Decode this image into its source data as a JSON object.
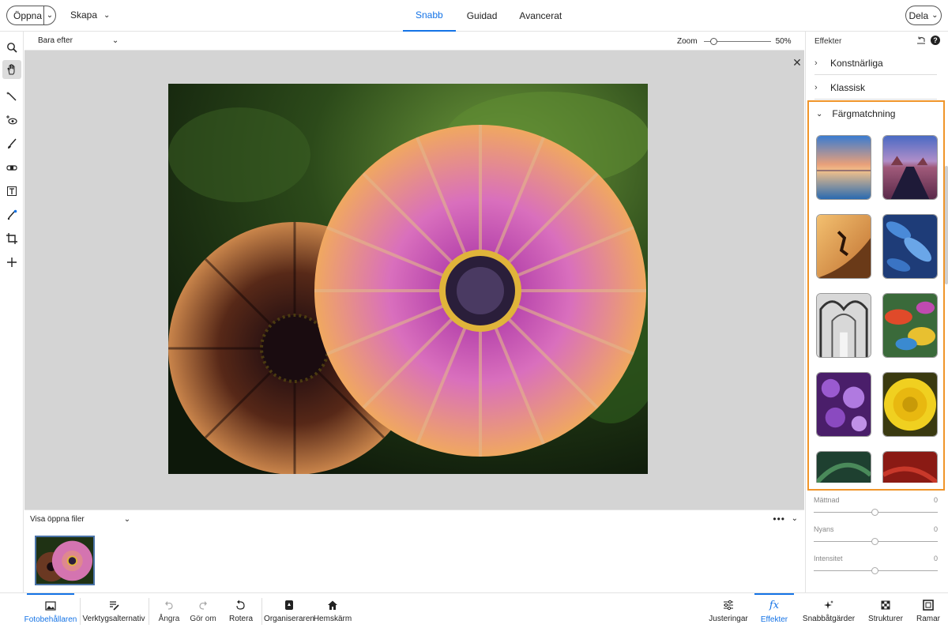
{
  "topbar": {
    "open_label": "Öppna",
    "create_label": "Skapa",
    "modes": [
      "Snabb",
      "Guidad",
      "Avancerat"
    ],
    "active_mode": "Snabb",
    "share_label": "Dela"
  },
  "options": {
    "view_select": "Bara efter",
    "zoom_label": "Zoom",
    "zoom_value": "50%",
    "zoom_fraction": 0.5
  },
  "filestrip": {
    "label": "Visa öppna filer"
  },
  "panel": {
    "title": "Effekter",
    "categories": [
      {
        "label": "Konstnärliga",
        "expanded": false
      },
      {
        "label": "Klassisk",
        "expanded": false
      },
      {
        "label": "Färgmatchning",
        "expanded": true
      }
    ],
    "sliders": [
      {
        "label": "Mättnad",
        "value": "0"
      },
      {
        "label": "Nyans",
        "value": "0"
      },
      {
        "label": "Intensitet",
        "value": "0"
      }
    ]
  },
  "bottombar": {
    "items": [
      {
        "label": "Fotobehållaren",
        "icon": "photo-bin-icon"
      },
      {
        "label": "Verktygsalternativ",
        "icon": "tool-options-icon"
      },
      {
        "label": "Ångra",
        "icon": "undo-icon"
      },
      {
        "label": "Gör om",
        "icon": "redo-icon"
      },
      {
        "label": "Rotera",
        "icon": "rotate-icon"
      },
      {
        "label": "Organiseraren",
        "icon": "organizer-icon"
      },
      {
        "label": "Hemskärm",
        "icon": "home-icon"
      },
      {
        "label": "Justeringar",
        "icon": "adjustments-icon"
      },
      {
        "label": "Effekter",
        "icon": "effects-icon"
      },
      {
        "label": "Snabbåtgärder",
        "icon": "quick-actions-icon"
      },
      {
        "label": "Strukturer",
        "icon": "textures-icon"
      },
      {
        "label": "Ramar",
        "icon": "frames-icon"
      }
    ]
  },
  "colors": {
    "accent": "#1473e6",
    "highlight": "#f0952a"
  }
}
